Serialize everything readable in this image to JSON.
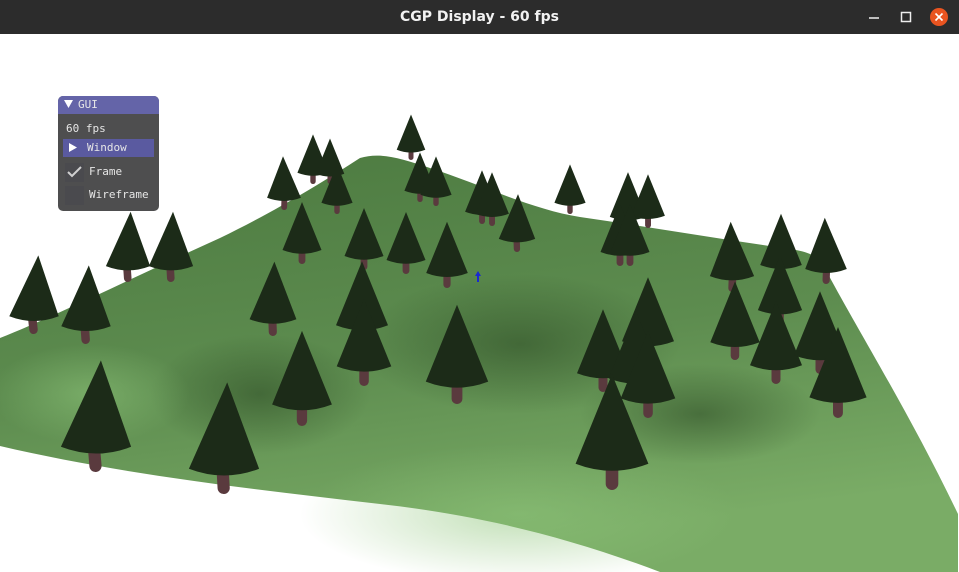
{
  "window": {
    "title": "CGP Display - 60 fps",
    "controls": [
      "minimize-icon",
      "maximize-icon",
      "close-icon"
    ]
  },
  "gui": {
    "header_label": "GUI",
    "fps_text": "60 fps",
    "window_node_label": "Window",
    "checkboxes": [
      {
        "label": "Frame",
        "checked": true
      },
      {
        "label": "Wireframe",
        "checked": false
      }
    ]
  },
  "scene": {
    "terrain_color": "#5e8c4e",
    "tree_foliage_color": "#1c2b18",
    "tree_trunk_color": "#5a3a3e",
    "background_color": "#ffffff"
  },
  "colors": {
    "titlebar": "#2c2c2c",
    "close_button": "#e95420",
    "gui_header": "#6464a8",
    "gui_background": "#1c1c1e"
  }
}
